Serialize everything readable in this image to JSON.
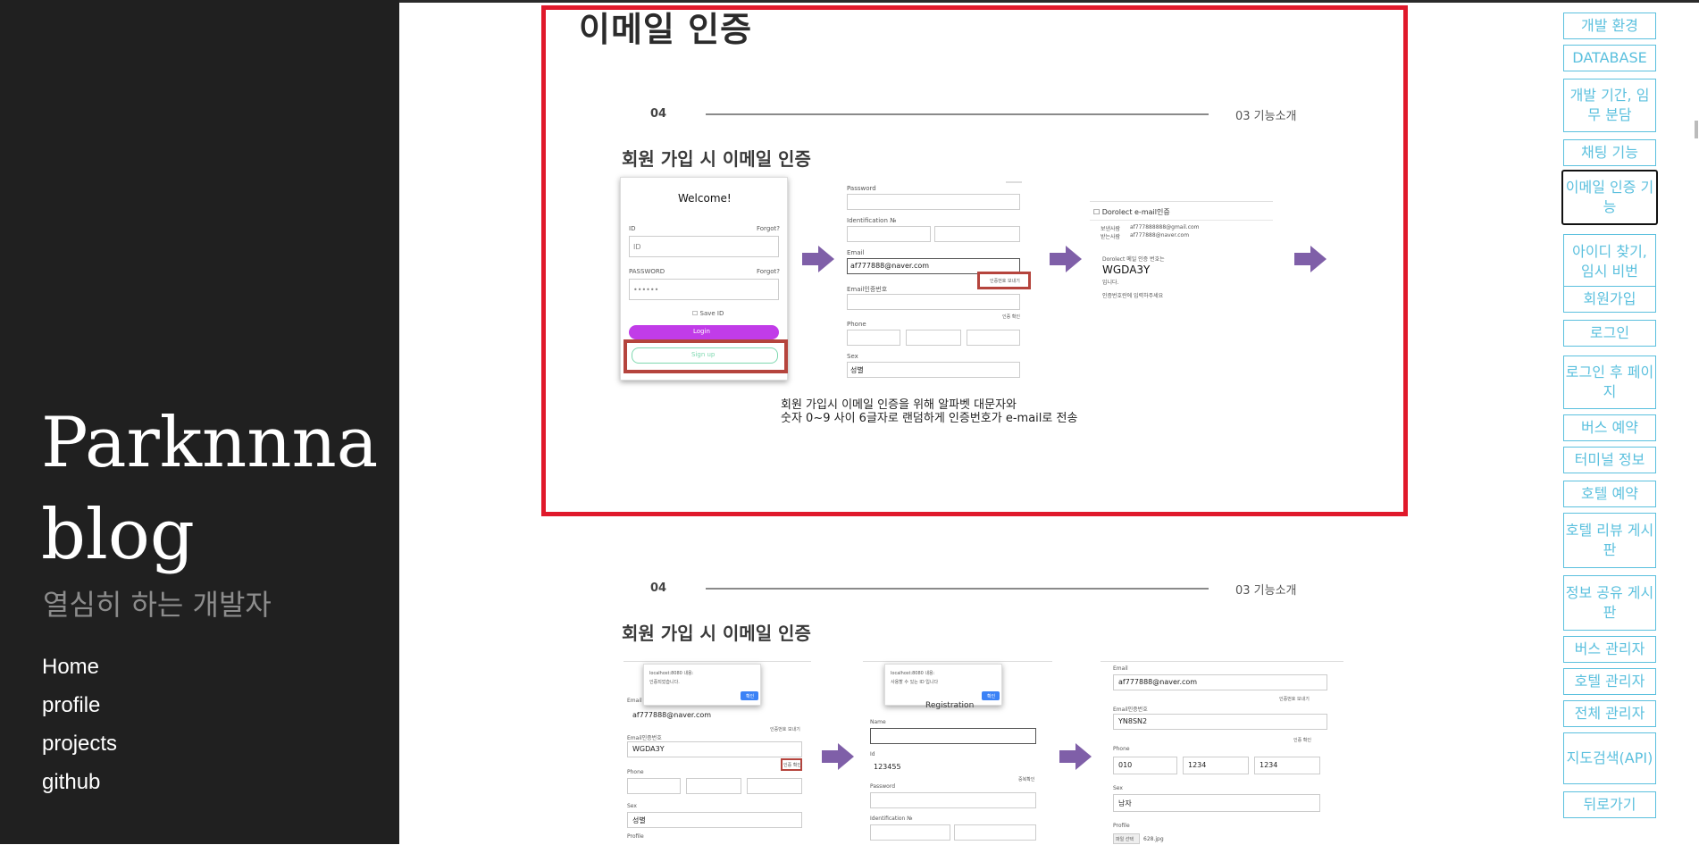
{
  "sidebar": {
    "title_line1": "Parknnna",
    "title_line2": "blog",
    "subtitle": "열심히 하는 개발자",
    "nav": [
      "Home",
      "profile",
      "projects",
      "github"
    ]
  },
  "main": {
    "section_title": "이메일 인증",
    "slide1": {
      "num": "04",
      "category": "03  기능소개",
      "heading": "회원 가입 시 이메일 인증",
      "login_card": {
        "welcome": "Welcome!",
        "id_label": "ID",
        "forgot1": "Forgot?",
        "id_placeholder": "ID",
        "password_label": "PASSWORD",
        "forgot2": "Forgot?",
        "password_value": "••••••",
        "save_id": "Save ID",
        "login": "Login",
        "signup": "Sign up"
      },
      "register_form": {
        "password_label": "Password",
        "ident_label": "Identification №",
        "email_label": "Email",
        "email_value": "af777888@naver.com",
        "send_code": "인증번호 보내기",
        "email_code_label": "Email인증번호",
        "confirm": "인증 확인",
        "phone_label": "Phone",
        "sex_label": "Sex",
        "sex_value": "성별"
      },
      "mail": {
        "subject": "Dorolect e-mail인증",
        "from_label": "보낸사람",
        "from_value": "af777888888@gmail.com",
        "to_label": "받는사람",
        "to_value": "af777888@naver.com",
        "body1": "Dorolect 메일 인증 번호는",
        "code": "WGDA3Y",
        "body2": "입니다.",
        "body3": "인증번호란에 입력하주세요"
      },
      "caption_line1": "회원 가입시 이메일 인증을 위해 알파벳 대문자와",
      "caption_line2": "숫자 0~9 사이 6글자로 랜덤하게 인증번호가 e-mail로 전송"
    },
    "slide2": {
      "num": "04",
      "category": "03  기능소개",
      "heading": "회원 가입 시 이메일 인증",
      "panel1": {
        "alert_title": "localhost:8080 내용:",
        "alert_msg": "인증되었습니다.",
        "alert_ok": "확인",
        "email_label": "Email",
        "email_value": "af777888@naver.com",
        "send_code": "인증번호 보내기",
        "code_label": "Email인증번호",
        "code_value": "WGDA3Y",
        "confirm": "인증 확인",
        "phone_label": "Phone",
        "sex_label": "Sex",
        "sex_value": "성별",
        "profile_label": "Profile"
      },
      "panel2": {
        "alert_title": "localhost:8080 내용:",
        "alert_msg": "사용할 수 있는 ID 입니다",
        "alert_ok": "확인",
        "header": "Registration",
        "name_label": "Name",
        "id_label": "Id",
        "id_value": "123455",
        "dup_check": "중복확인",
        "password_label": "Password",
        "ident_label": "Identification №"
      },
      "panel3": {
        "email_label": "Email",
        "email_value": "af777888@naver.com",
        "send_code": "인증번호 보내기",
        "code_label": "Email인증번호",
        "code_value": "YN8SN2",
        "confirm": "인증 확인",
        "phone_label": "Phone",
        "phone1": "010",
        "phone2": "1234",
        "phone3": "1234",
        "sex_label": "Sex",
        "sex_value": "남자",
        "profile_label": "Profile",
        "file_btn": "파일 선택",
        "file_name": "628.jpg"
      }
    }
  },
  "toc": [
    "개발 환경",
    "DATABASE",
    "개발 기간, 임무 분담",
    "채팅 기능",
    "이메일 인증 기능",
    "아이디 찾기, 임시 비번",
    "회원가입",
    "로그인",
    "로그인 후 페이지",
    "버스 예약",
    "터미널 정보",
    "호텔 예약",
    "호텔 리뷰 게시판",
    "정보 공유 게시판",
    "버스 관리자",
    "호텔 관리자",
    "전체 관리자",
    "지도검색(API)",
    "뒤로가기"
  ],
  "colors": {
    "sidebar_bg": "#202020",
    "highlight": "#e0192b",
    "toc_accent": "#5bc0de",
    "arrow": "#7f5fa8",
    "login_button": "#c13ce8"
  }
}
